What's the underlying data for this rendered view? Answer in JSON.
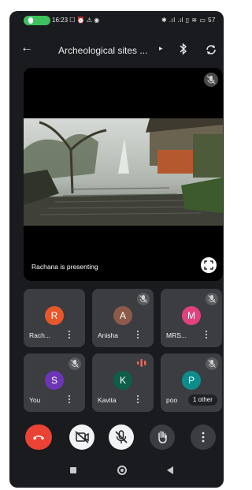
{
  "status_bar": {
    "time_and_notifications": "16:23 ☐ ⏰ ⚠ ◉",
    "right_indicators": "✱ .ıl .ıl ▯ ≋ ▭ 57",
    "call_indicator_color": "#3ec25e"
  },
  "header": {
    "back_icon": "arrow-left-icon",
    "title": "Archeological sites ...",
    "title_chevron": "▸",
    "bluetooth_icon": "bluetooth-icon",
    "switch_camera_icon": "switch-camera-icon"
  },
  "presentation": {
    "caption": "Rachana is presenting",
    "mic_state": "muted",
    "fullscreen_icon": "fullscreen-icon"
  },
  "participants": [
    {
      "initial": "R",
      "name": "Rach...",
      "color": "#e8572a",
      "mic": "on"
    },
    {
      "initial": "A",
      "name": "Anisha",
      "color": "#8d5a4a",
      "mic": "muted"
    },
    {
      "initial": "M",
      "name": "MRS...",
      "color": "#e0417f",
      "mic": "muted"
    },
    {
      "initial": "S",
      "name": "You",
      "color": "#6c35b8",
      "mic": "muted"
    },
    {
      "initial": "K",
      "name": "Kavita",
      "color": "#0f5e4a",
      "mic": "speaking"
    },
    {
      "initial": "P",
      "name": "poo",
      "color": "#0e8c8c",
      "mic": "muted",
      "others_label": "1 other"
    }
  ],
  "controls": {
    "end_call_color": "#ea4335",
    "camera_state": "off",
    "mic_state": "muted",
    "items": [
      "end-call",
      "camera-off",
      "mic-off",
      "raise-hand",
      "more-options"
    ]
  },
  "nav": [
    "recent-apps",
    "home",
    "back"
  ]
}
